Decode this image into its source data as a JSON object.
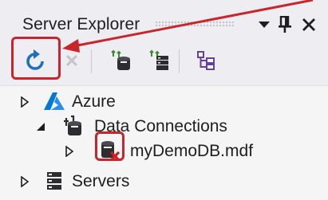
{
  "panel": {
    "title": "Server Explorer",
    "buttons": {
      "dropdown": "▼",
      "pin": "ᆔ",
      "close": "✕"
    }
  },
  "toolbar": {
    "items": [
      {
        "name": "refresh",
        "icon": "refresh-icon",
        "enabled": true
      },
      {
        "name": "stop-refresh",
        "icon": "stop-icon",
        "enabled": false
      },
      {
        "name": "connect-to-database",
        "icon": "connect-database-icon",
        "enabled": true
      },
      {
        "name": "connect-to-server",
        "icon": "connect-server-icon",
        "enabled": true
      },
      {
        "name": "sharepoint-connection",
        "icon": "hierarchy-icon",
        "enabled": true
      }
    ]
  },
  "tree": {
    "nodes": [
      {
        "label": "Azure",
        "icon": "azure-icon",
        "expanded": false
      },
      {
        "label": "Data Connections",
        "icon": "data-connections-icon",
        "expanded": true
      },
      {
        "label": "myDemoDB.mdf",
        "icon": "database-error-icon",
        "expanded": false
      },
      {
        "label": "Servers",
        "icon": "servers-icon",
        "expanded": false
      }
    ]
  },
  "colors": {
    "highlight": "#c8262d",
    "refresh_blue": "#1e6fbf",
    "error_red": "#d11a1a",
    "azure_blue": "#0078d4",
    "panel_bg": "#eeeef2",
    "text": "#1e1e1e"
  }
}
